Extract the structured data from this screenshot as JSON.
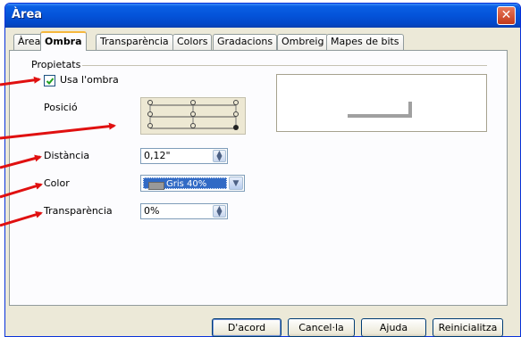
{
  "window": {
    "title": "Àrea",
    "close_glyph": "✕"
  },
  "tabs": [
    {
      "label": "Àrea"
    },
    {
      "label": "Ombra",
      "active": true
    },
    {
      "label": "Transparència"
    },
    {
      "label": "Colors"
    },
    {
      "label": "Gradacions"
    },
    {
      "label": "Ombreig"
    },
    {
      "label": "Mapes de bits"
    }
  ],
  "properties": {
    "group_label": "Propietats",
    "use_shadow": {
      "label": "Usa l'ombra",
      "checked": true
    },
    "position_label": "Posició",
    "distance": {
      "label": "Distància",
      "value": "0,12\""
    },
    "color": {
      "label": "Color",
      "value": "Gris 40%",
      "swatch": "#999999"
    },
    "transparency": {
      "label": "Transparència",
      "value": "0%"
    }
  },
  "buttons": {
    "ok": "D'acord",
    "cancel": "Cancel·la",
    "help": "Ajuda",
    "reset": "Reinicialitza"
  },
  "colors": {
    "annotation_arrow": "#e01010",
    "titlebar": "#0453d9"
  }
}
